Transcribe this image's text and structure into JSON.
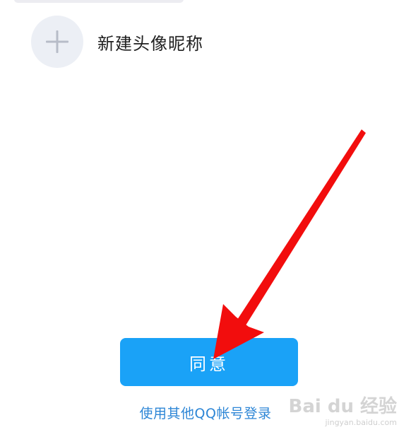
{
  "new_profile": {
    "label": "新建头像昵称",
    "icon": "plus-icon"
  },
  "actions": {
    "agree_label": "同意",
    "other_account_label": "使用其他QQ帐号登录"
  },
  "watermark": {
    "logo_text": "Bai du 经验",
    "url_text": "jingyan.baidu.com"
  },
  "colors": {
    "primary_button": "#1aa2f7",
    "link": "#2d86d6",
    "arrow": "#f20d0d",
    "icon_circle": "#eceff5"
  }
}
